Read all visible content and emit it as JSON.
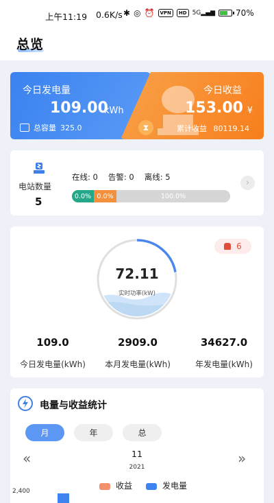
{
  "status_bar": {
    "time": "上午11:19",
    "speed": "0.6K/s",
    "vpn": "VPN",
    "hd": "HD",
    "signal_type": "5G",
    "battery_pct": "70",
    "battery_level": 0.7
  },
  "header": {
    "title": "总览"
  },
  "today_energy": {
    "label": "今日发电量",
    "value": "109.00",
    "unit": "kWh",
    "capacity_label": "总容量",
    "capacity_value": "325.0"
  },
  "today_income": {
    "label": "今日收益",
    "value": "153.00",
    "unit": "¥",
    "cumulative_label": "累计收益",
    "cumulative_value": "80119.14"
  },
  "station": {
    "label": "电站数量",
    "count": "5",
    "online_label": "在线:",
    "online": "0",
    "alarm_label": "告警:",
    "alarm": "0",
    "offline_label": "离线:",
    "offline": "5",
    "bar": {
      "online_pct": "0.0%",
      "alarm_pct": "0.0%",
      "offline_pct": "100.0%"
    }
  },
  "power": {
    "alarm_count": "6",
    "realtime_value": "72.11",
    "realtime_label": "实时功率(kW)",
    "gauge_fraction": 0.22,
    "stats": [
      {
        "value": "109.0",
        "label": "今日发电量(kWh)"
      },
      {
        "value": "2909.0",
        "label": "本月发电量(kWh)"
      },
      {
        "value": "34627.0",
        "label": "年发电量(kWh)"
      }
    ]
  },
  "chart_section": {
    "title": "电量与收益统计",
    "tabs": [
      "月",
      "年",
      "总"
    ],
    "active_tab": "月",
    "prev": "«",
    "next": "»",
    "month": "11",
    "year": "2021",
    "legend": [
      {
        "name": "收益",
        "color": "#f4906c"
      },
      {
        "name": "发电量",
        "color": "#3d84f0"
      }
    ],
    "y_tick": "2,400"
  }
}
